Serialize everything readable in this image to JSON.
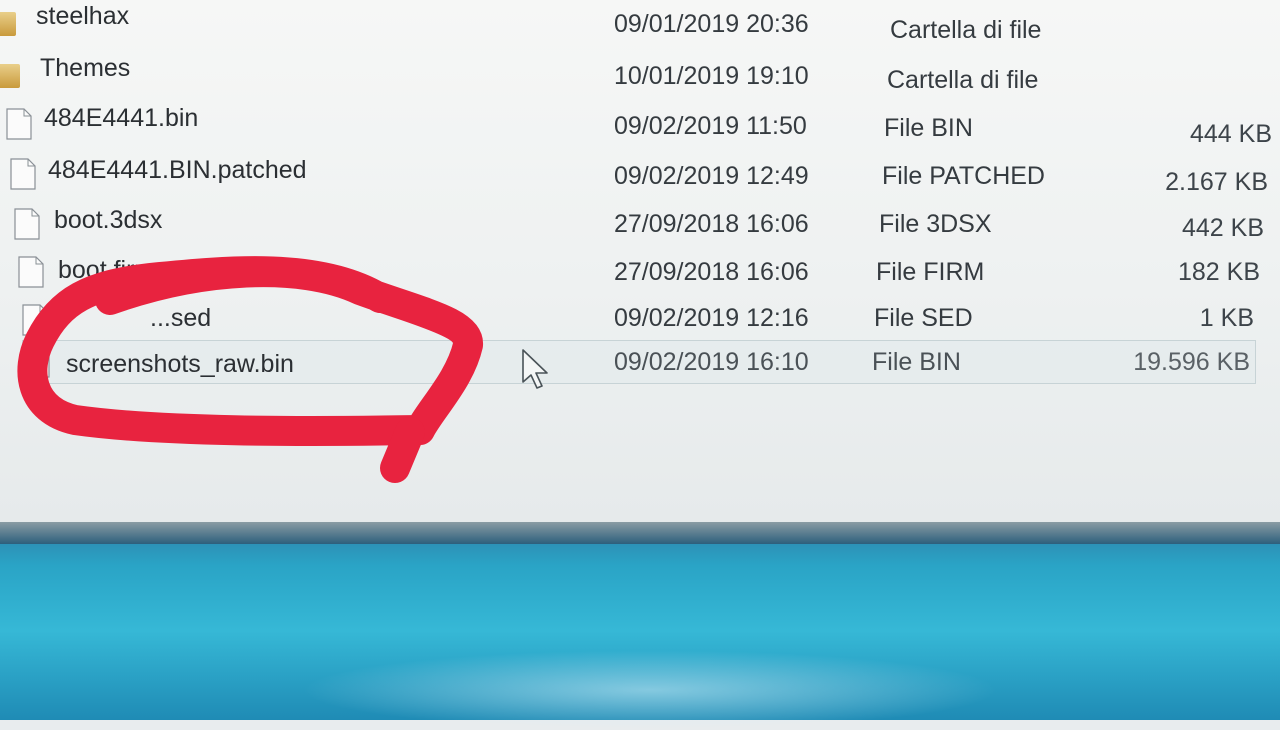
{
  "files": [
    {
      "name": "steelhax",
      "date": "09/01/2019 20:36",
      "type": "Cartella di file",
      "size": "",
      "icon": "folder-icon"
    },
    {
      "name": "Themes",
      "date": "10/01/2019 19:10",
      "type": "Cartella di file",
      "size": "",
      "icon": "folder-icon"
    },
    {
      "name": "484E4441.bin",
      "date": "09/02/2019 11:50",
      "type": "File BIN",
      "size": "444 KB",
      "icon": "file-icon"
    },
    {
      "name": "484E4441.BIN.patched",
      "date": "09/02/2019 12:49",
      "type": "File PATCHED",
      "size": "2.167 KB",
      "icon": "file-icon"
    },
    {
      "name": "boot.3dsx",
      "date": "27/09/2018 16:06",
      "type": "File 3DSX",
      "size": "442 KB",
      "icon": "file-icon"
    },
    {
      "name": "boot.firm",
      "date": "27/09/2018 16:06",
      "type": "File FIRM",
      "size": "182 KB",
      "icon": "file-icon"
    },
    {
      "name": "...sed",
      "date": "09/02/2019 12:16",
      "type": "File SED",
      "size": "1 KB",
      "icon": "file-icon"
    },
    {
      "name": "screenshots_raw.bin",
      "date": "09/02/2019 16:10",
      "type": "File BIN",
      "size": "19.596 KB",
      "icon": "file-icon",
      "selected": true
    }
  ],
  "colors": {
    "annotation": "#e8233f",
    "taskbar": "#2aa4c6"
  }
}
